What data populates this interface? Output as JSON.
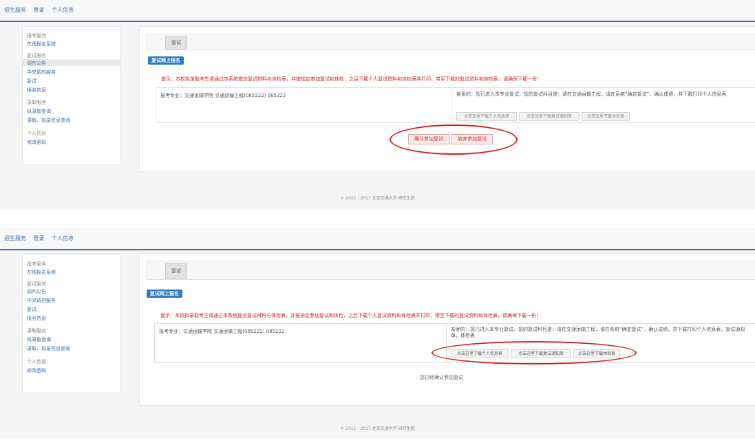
{
  "screen1": {
    "top_nav": [
      "招生服务",
      "登录",
      "个人信息"
    ],
    "sidebar": {
      "groups": [
        {
          "title": "报考服务",
          "items": [
            "在线报名系统"
          ]
        },
        {
          "title": "复试服务",
          "items": [
            "调剂公告",
            "中央调剂服务",
            "复试",
            "报名信息"
          ]
        },
        {
          "title": "录取服务",
          "items": [
            "拟录取查询",
            "录取、拟录信息查询"
          ]
        },
        {
          "title": "个人信息",
          "items": [
            "修改密码"
          ]
        }
      ]
    },
    "tab_label": "复试",
    "section_badge": "复试网上报名",
    "warning": "提示：本校拟录取考生请通过本系统提交复试材料与体检表，并按规定参加复试和体检，之后下载个人复试资料和体检表并打印，带至下载的复试资料和体检表，请确保下载一份！",
    "apply_info": "报考专业：交通运输学院 交通运输工程(085222) 085222",
    "right_info": "亲爱的：您已进入本专业复试，您的复试科目是：请在交通运输工程，请在系统“确定复试”，确认成绩，并下载打印个人信息表",
    "grey_buttons": [
      "点击这里下载个人信息表",
      "点击这里下载复试通知单",
      "点击这里下载体检表"
    ],
    "red_buttons": [
      "确认参加复试",
      "放弃参加复试"
    ],
    "footer": "© 2011 - 2017 北京交通大学 研究生院"
  },
  "screen2": {
    "top_nav": [
      "招生服务",
      "登录",
      "个人信息"
    ],
    "sidebar": {
      "groups": [
        {
          "title": "报考服务",
          "items": [
            "在线报名系统"
          ]
        },
        {
          "title": "复试服务",
          "items": [
            "调剂公告",
            "中央调剂服务",
            "复试",
            "报名信息"
          ]
        },
        {
          "title": "录取服务",
          "items": [
            "拟录取查询",
            "录取、拟录信息查询"
          ]
        },
        {
          "title": "个人信息",
          "items": [
            "修改密码"
          ]
        }
      ]
    },
    "tab_label": "复试",
    "section_badge": "复试网上报名",
    "warning": "提示：本校拟录取考生请通过本系统提交复试材料与体检表，并按规定参加复试和体检，之后下载个人复试资料和体检表并打印，带至下载的复试资料和体检表，请确保下载一份！",
    "apply_info": "报考专业：交通运输学院 交通运输工程(085222) 085222",
    "right_info": "亲爱的：您已进入本专业复试，您的复试科目是：请在交通运输工程，请在系统“确定复试”，确认成绩，并下载打印个人信息表，复试通知单，体检表",
    "download_buttons": [
      "点击这里下载个人信息表",
      "点击这里下载复试通知单",
      "点击这里下载体检表"
    ],
    "confirmed_text": "您已经确认参加复试",
    "footer": "© 2011 - 2017 北京交通大学 研究生院"
  },
  "colors": {
    "accent": "#2f7bc4",
    "warning": "#cc2222",
    "circle": "#d42222"
  }
}
